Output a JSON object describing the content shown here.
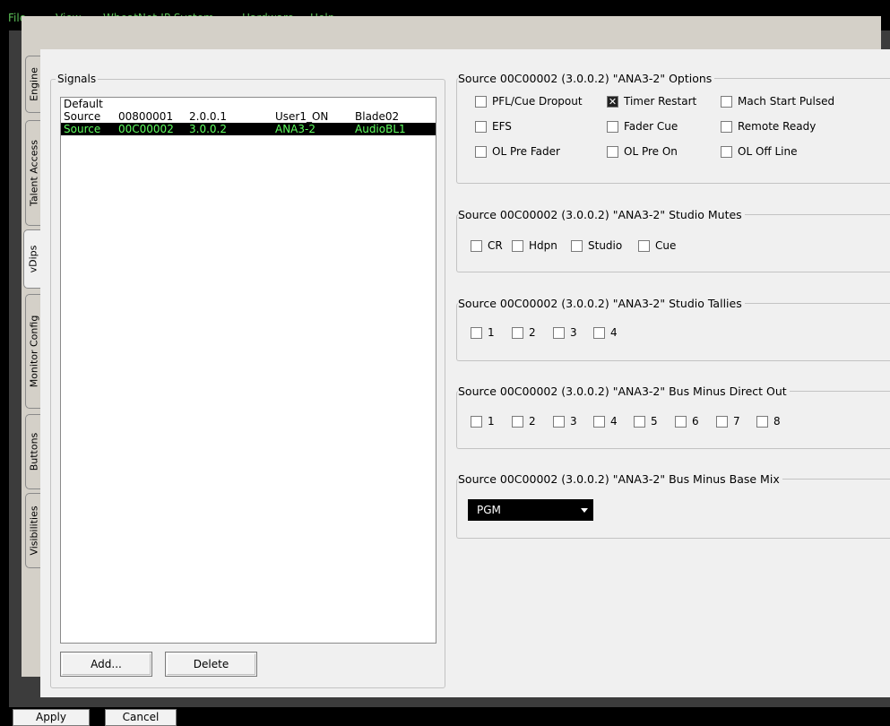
{
  "menu": [
    "File",
    "View",
    "WheatNet-IP System",
    "Hardware",
    "Help"
  ],
  "tabs": [
    {
      "label": "Engine",
      "active": false
    },
    {
      "label": "Talent Access",
      "active": false
    },
    {
      "label": "vDips",
      "active": true
    },
    {
      "label": "Monitor Config",
      "active": false
    },
    {
      "label": "Buttons",
      "active": false
    },
    {
      "label": "Visibilities",
      "active": false
    }
  ],
  "signals": {
    "title": "Signals",
    "rows": [
      {
        "c1": "Default",
        "c2": "",
        "c3": "",
        "c4": "",
        "c5": "",
        "selected": false
      },
      {
        "c1": "Source",
        "c2": "00800001",
        "c3": "2.0.0.1",
        "c4": "User1_ON",
        "c5": "Blade02",
        "selected": false
      },
      {
        "c1": "Source",
        "c2": "00C00002",
        "c3": "3.0.0.2",
        "c4": "ANA3-2",
        "c5": "AudioBL1",
        "selected": true
      }
    ],
    "add_label": "Add...",
    "delete_label": "Delete"
  },
  "options": {
    "title": "Source 00C00002 (3.0.0.2) \"ANA3-2\" Options",
    "items": [
      {
        "label": "PFL/Cue Dropout",
        "checked": false
      },
      {
        "label": "Timer Restart",
        "checked": true
      },
      {
        "label": "Mach Start Pulsed",
        "checked": false
      },
      {
        "label": "EFS",
        "checked": false
      },
      {
        "label": "Fader Cue",
        "checked": false
      },
      {
        "label": "Remote Ready",
        "checked": false
      },
      {
        "label": "OL Pre Fader",
        "checked": false
      },
      {
        "label": "OL Pre On",
        "checked": false
      },
      {
        "label": "OL Off Line",
        "checked": false
      }
    ]
  },
  "mutes": {
    "title": "Source 00C00002 (3.0.0.2) \"ANA3-2\" Studio Mutes",
    "items": [
      "CR",
      "Hdpn",
      "Studio",
      "Cue"
    ]
  },
  "tallies": {
    "title": "Source 00C00002 (3.0.0.2) \"ANA3-2\" Studio Tallies",
    "items": [
      "1",
      "2",
      "3",
      "4"
    ]
  },
  "direct_out": {
    "title": "Source 00C00002 (3.0.0.2) \"ANA3-2\" Bus Minus Direct Out",
    "items": [
      "1",
      "2",
      "3",
      "4",
      "5",
      "6",
      "7",
      "8"
    ]
  },
  "base_mix": {
    "title": "Source 00C00002 (3.0.0.2) \"ANA3-2\" Bus Minus Base Mix",
    "value": "PGM"
  },
  "footer": {
    "apply_label": "Apply",
    "cancel_label": "Cancel"
  },
  "colors": {
    "menu_text": "#5bbf57",
    "selected_row_text": "#5fff5f"
  }
}
